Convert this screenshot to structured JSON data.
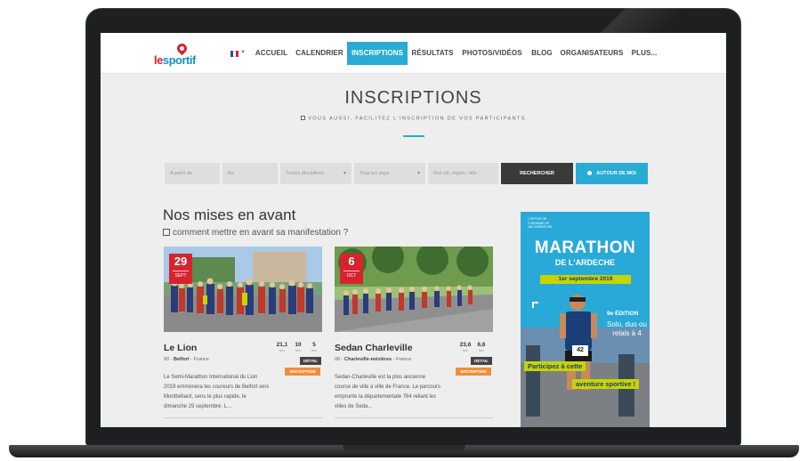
{
  "nav": {
    "logo": {
      "part1": "le",
      "part2": "sportif"
    },
    "items": [
      "ACCUEIL",
      "CALENDRIER",
      "INSCRIPTIONS",
      "RÉSULTATS",
      "PHOTOS/VIDÉOS",
      "BLOG",
      "ORGANISATEURS",
      "PLUS..."
    ],
    "active_color": "#29abd4"
  },
  "header": {
    "title": "INSCRIPTIONS",
    "subtitle": "VOUS AUSSI, FACILITEZ L'INSCRIPTION DE VOS PARTICIPANTS"
  },
  "filters": {
    "from_placeholder": "A partir du",
    "to_placeholder": "Au",
    "discipline": "Toutes disciplines",
    "country": "Tous les pays",
    "keyword_placeholder": "Mot clé, région, ville",
    "search_label": "RECHERCHER",
    "near_label": "AUTOUR DE MOI"
  },
  "featured": {
    "title": "Nos mises en avant",
    "link": "comment mettre en avant sa manifestation ?",
    "cards": [
      {
        "day": "29",
        "month": "SEPT",
        "name": "Le Lion",
        "dept": "90 -",
        "city": "Belfort",
        "country": "- France",
        "stats": [
          {
            "v": "21,1",
            "u": "km"
          },
          {
            "v": "10",
            "u": "km"
          },
          {
            "v": "5",
            "u": "km"
          }
        ],
        "detail": "DÉTAIL",
        "inscription": "INSCRIPTION",
        "desc": "Le Semi-Marathon International du Lion 2019 emmènera les coureurs de Belfort vers Montbéliard, sens le plus rapide, le dimanche 29 septembre. L..."
      },
      {
        "day": "6",
        "month": "OCT",
        "name": "Sedan Charleville",
        "dept": "08 -",
        "city": "Charleville-mézières",
        "country": "- France",
        "stats": [
          {
            "v": "23,6",
            "u": "km"
          },
          {
            "v": "6,6",
            "u": "km"
          }
        ],
        "detail": "DÉTAIL",
        "inscription": "INSCRIPTION",
        "desc": "Sedan-Charleville est la plus ancienne course de ville à ville de France. Le parcours emprunte la départementale 764 reliant les villes de Seda..."
      }
    ]
  },
  "ad": {
    "office": "L'OFFICE DE TOURISME DE VAL'D'ARDÈCHE",
    "title": "MARATHON",
    "subtitle": "DE L'ARDECHE",
    "date": "1er septembre 2019",
    "edition": "9e ÉDITION",
    "formats": "Solo, duo ou relais à 4",
    "bib": "42",
    "tagline1": "Participez à cette",
    "tagline2": "aventure sportive !"
  }
}
